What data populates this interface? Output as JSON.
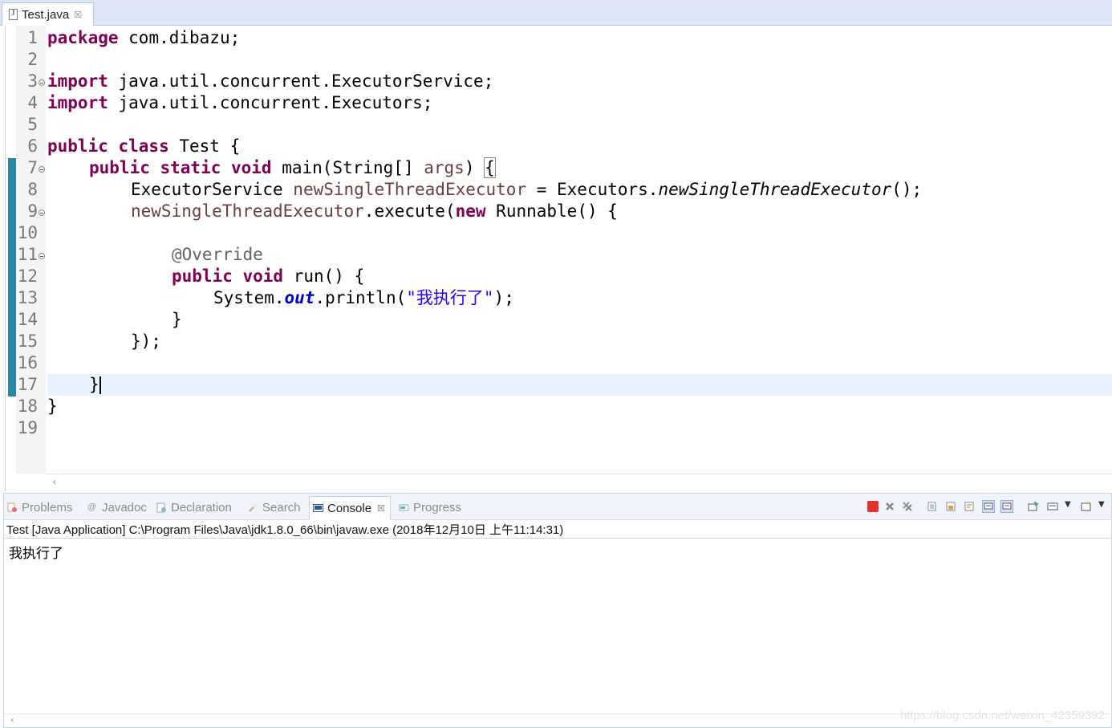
{
  "editor_tab": {
    "title": "Test.java",
    "close": "☒"
  },
  "code_lines": [
    {
      "num": "1"
    },
    {
      "num": "2"
    },
    {
      "num": "3"
    },
    {
      "num": "4"
    },
    {
      "num": "5"
    },
    {
      "num": "6"
    },
    {
      "num": "7"
    },
    {
      "num": "8"
    },
    {
      "num": "9"
    },
    {
      "num": "10"
    },
    {
      "num": "11"
    },
    {
      "num": "12"
    },
    {
      "num": "13"
    },
    {
      "num": "14"
    },
    {
      "num": "15"
    },
    {
      "num": "16"
    },
    {
      "num": "17"
    },
    {
      "num": "18"
    },
    {
      "num": "19"
    }
  ],
  "code": {
    "l1_kw": "package",
    "l1_rest": " com.dibazu;",
    "l3_kw": "import",
    "l3_rest": " java.util.concurrent.ExecutorService;",
    "l4_kw": "import",
    "l4_rest": " java.util.concurrent.Executors;",
    "l6_kw": "public class",
    "l6_rest": " Test {",
    "l7_kw": "public static void",
    "l7_a": " main(String[] ",
    "l7_var": "args",
    "l7_b": ") ",
    "l7_brace": "{",
    "l8_a": "ExecutorService ",
    "l8_var": "newSingleThreadExecutor",
    "l8_b": " = Executors.",
    "l8_method": "newSingleThreadExecutor",
    "l8_c": "();",
    "l9_var": "newSingleThreadExecutor",
    "l9_a": ".execute(",
    "l9_kw": "new",
    "l9_b": " Runnable() {",
    "l11_ann": "@Override",
    "l12_kw": "public void",
    "l12_rest": " run() {",
    "l13_a": "System.",
    "l13_fld": "out",
    "l13_b": ".println(",
    "l13_str": "\"我执行了\"",
    "l13_c": ");",
    "l14": "}",
    "l15": "});",
    "l17": "}",
    "l18": "}"
  },
  "panel": {
    "tabs": [
      {
        "label": "Problems"
      },
      {
        "label": "Javadoc"
      },
      {
        "label": "Declaration"
      },
      {
        "label": "Search"
      },
      {
        "label": "Console",
        "active": true
      },
      {
        "label": "Progress"
      }
    ],
    "console_close": "☒",
    "console_header": "Test [Java Application] C:\\Program Files\\Java\\jdk1.8.0_66\\bin\\javaw.exe (2018年12月10日 上午11:14:31)",
    "console_output": "我执行了"
  },
  "watermark": "https://blog.csdn.net/weixin_42359392",
  "colors": {
    "keyword": "#7f0055",
    "string": "#2a00ff",
    "field": "#0000c0",
    "annotation": "#646464",
    "current_line": "#e8f2fe",
    "change_bar": "#2d86a2"
  }
}
